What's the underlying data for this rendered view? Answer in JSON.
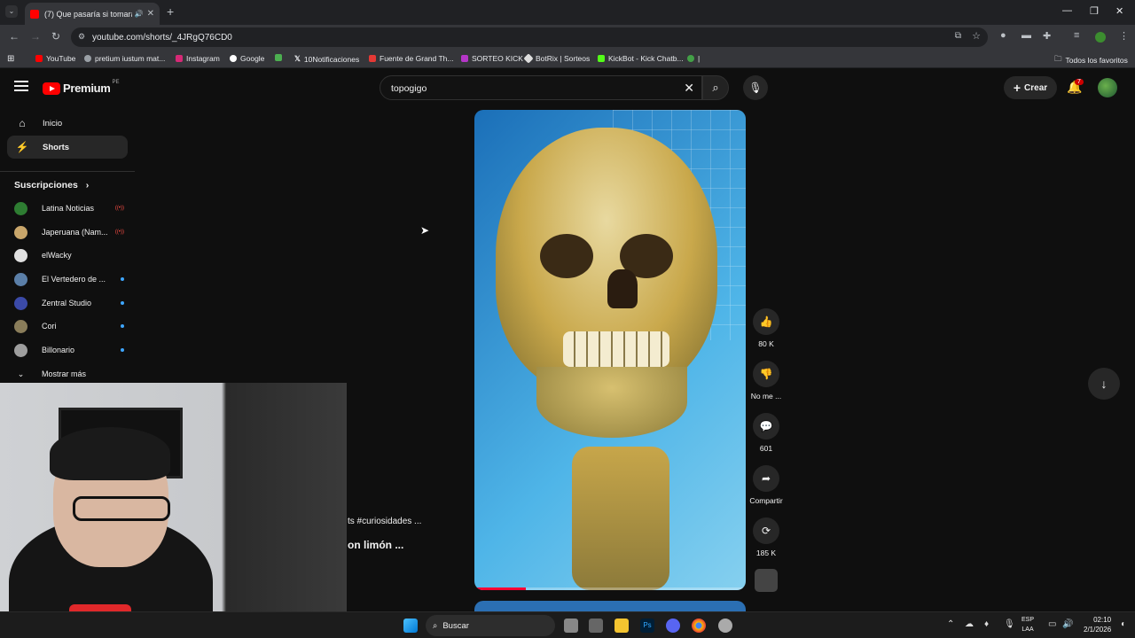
{
  "browser": {
    "tab_title": "(7) Que pasaría si tomaras ...",
    "url": "youtube.com/shorts/_4JRgQ76CD0",
    "bookmarks": [
      "YouTube",
      "pretium iustum mat...",
      "Instagram",
      "Google",
      "",
      "10Notificaciones",
      "Fuente de Grand Th...",
      "SORTEO KICK",
      "BotRix | Sorteos",
      "KickBot - Kick Chatb...",
      "|"
    ],
    "all_bookmarks": "Todos los favoritos"
  },
  "header": {
    "logo_text": "Premium",
    "region": "PE",
    "search_value": "topogigo",
    "create_label": "Crear",
    "notifications": "7"
  },
  "sidebar": {
    "items": [
      {
        "label": "Inicio",
        "icon": "home-icon"
      },
      {
        "label": "Shorts",
        "icon": "shorts-icon"
      }
    ],
    "subscriptions_title": "Suscripciones",
    "subscriptions": [
      {
        "name": "Latina Noticias",
        "status": "live",
        "color": "#2e7d32"
      },
      {
        "name": "Japeruana (Nam...",
        "status": "live",
        "color": "#c9a66b"
      },
      {
        "name": "elWacky",
        "status": "none",
        "color": "#e0e0e0"
      },
      {
        "name": "El Vertedero de ...",
        "status": "new",
        "color": "#5b7fa8"
      },
      {
        "name": "Zentral Studio",
        "status": "new",
        "color": "#3b4aa8"
      },
      {
        "name": "Cori",
        "status": "new",
        "color": "#8a7d5a"
      },
      {
        "name": "Billonario",
        "status": "new",
        "color": "#9e9e9e"
      }
    ],
    "show_more": "Mostrar más"
  },
  "short": {
    "caption_tags": "ts #curiosidades ...",
    "caption_title": "on limón ...",
    "progress": 0.19,
    "actions": [
      {
        "name": "like",
        "label": "80 K",
        "icon": "thumbs-up-icon"
      },
      {
        "name": "dislike",
        "label": "No me ...",
        "icon": "thumbs-down-icon"
      },
      {
        "name": "comments",
        "label": "601",
        "icon": "comment-icon"
      },
      {
        "name": "share",
        "label": "Compartir",
        "icon": "share-icon"
      },
      {
        "name": "remix",
        "label": "185 K",
        "icon": "remix-icon"
      }
    ]
  },
  "taskbar": {
    "search": "Buscar",
    "lang_top": "ESP",
    "lang_bottom": "LAA",
    "time": "02:10",
    "date": "2/1/2026"
  }
}
